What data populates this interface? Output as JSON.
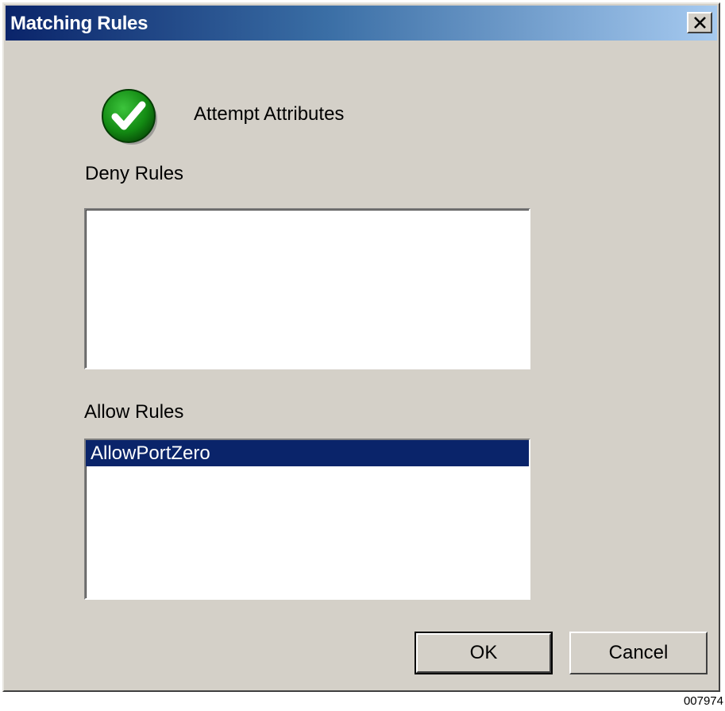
{
  "window": {
    "title": "Matching Rules"
  },
  "icons": {
    "close": "close-icon",
    "status": "checkmark-icon"
  },
  "colors": {
    "title_gradient_start": "#0a246a",
    "title_gradient_end": "#a6caf0",
    "dialog_background": "#d4d0c8",
    "selection": "#0a246a",
    "check_green": "#1a8a1a"
  },
  "status": {
    "label": "Attempt Attributes"
  },
  "deny_rules": {
    "label": "Deny Rules",
    "items": []
  },
  "allow_rules": {
    "label": "Allow Rules",
    "items": [
      {
        "label": "AllowPortZero",
        "selected": true
      }
    ]
  },
  "buttons": {
    "ok": "OK",
    "cancel": "Cancel"
  },
  "figure_id": "007974"
}
